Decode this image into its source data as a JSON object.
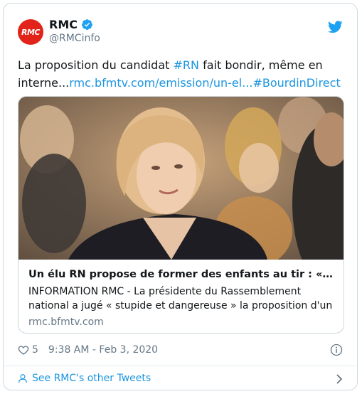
{
  "account": {
    "avatar_text": "RMC",
    "display_name": "RMC",
    "handle": "@RMCinfo",
    "verified": true
  },
  "tweet": {
    "text_prefix": "La proposition du candidat ",
    "hashtag_rn": "#RN",
    "text_mid": " fait bondir, même en interne...",
    "link_url": "rmc.bfmtv.com/emission/un-el...",
    "hashtag_bourdin": "#BourdinDirect"
  },
  "card": {
    "title": "Un élu RN propose de former des enfants au tir : « s…",
    "description": "INFORMATION RMC - La présidente du Rassemblement national a jugé « stupide et dangereuse » la proposition d'un",
    "domain": "rmc.bfmtv.com"
  },
  "meta": {
    "likes": "5",
    "timestamp": "9:38 AM - Feb 3, 2020"
  },
  "footer": {
    "see_more_label": "See RMC's other Tweets"
  },
  "colors": {
    "link": "#1b95e0",
    "avatar_bg": "#e2231a",
    "secondary_text": "#657786",
    "border": "#cfd9de"
  }
}
